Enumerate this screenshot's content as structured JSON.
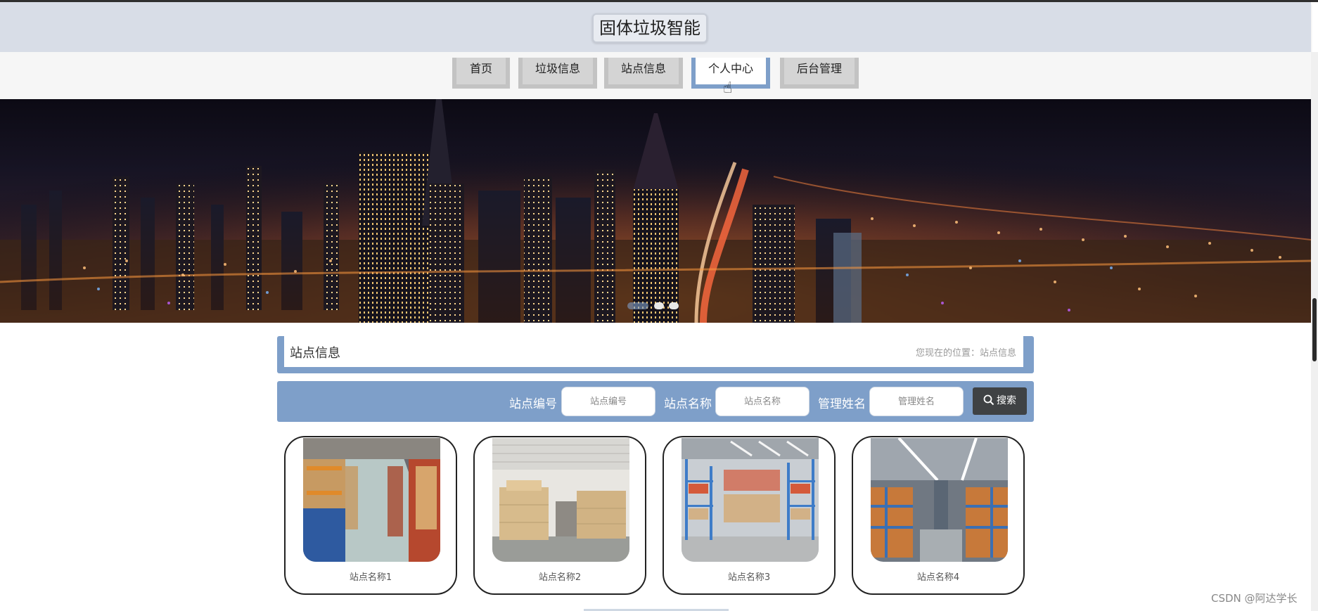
{
  "header": {
    "site_title": "固体垃圾智能"
  },
  "nav": {
    "items": [
      {
        "label": "首页"
      },
      {
        "label": "垃圾信息"
      },
      {
        "label": "站点信息"
      },
      {
        "label": "个人中心"
      },
      {
        "label": "后台管理"
      }
    ]
  },
  "banner": {
    "slides": 3,
    "active_slide": 1
  },
  "section": {
    "title": "站点信息",
    "location": "您现在的位置：站点信息"
  },
  "search": {
    "label1": "站点编号",
    "placeholder1": "站点编号",
    "label2": "站点名称",
    "placeholder2": "站点名称",
    "label3": "管理姓名",
    "placeholder3": "管理姓名",
    "button_label": "搜索"
  },
  "cards": [
    {
      "name": "站点名称1"
    },
    {
      "name": "站点名称2"
    },
    {
      "name": "站点名称3"
    },
    {
      "name": "站点名称4"
    }
  ],
  "watermark": "CSDN @阿达学长",
  "colors": {
    "accent": "#7e9fc9",
    "header_bg": "#d8dde7",
    "search_button": "#3f4244"
  }
}
